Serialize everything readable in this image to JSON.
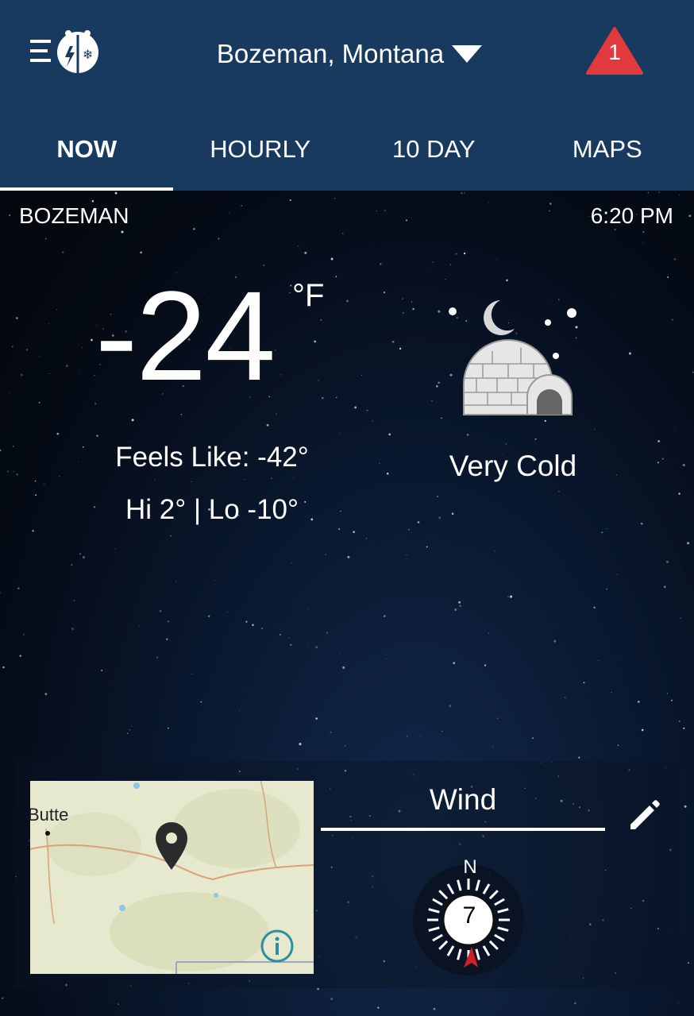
{
  "header": {
    "location": "Bozeman, Montana",
    "alert_count": "1",
    "menu_icon": "menu-logo-icon",
    "alert_icon": "alert-triangle-icon"
  },
  "tabs": [
    {
      "label": "NOW",
      "active": true
    },
    {
      "label": "HOURLY",
      "active": false
    },
    {
      "label": "10 DAY",
      "active": false
    },
    {
      "label": "MAPS",
      "active": false
    }
  ],
  "current": {
    "city": "BOZEMAN",
    "time": "6:20 PM",
    "temperature": "-24",
    "unit": "°F",
    "feels_like": "Feels Like: -42°",
    "hi_lo": "Hi 2° | Lo -10°",
    "condition": "Very Cold",
    "condition_icon": "igloo-moon-icon"
  },
  "map": {
    "label": "Butte",
    "info_icon": "info-icon",
    "pin_icon": "location-pin-icon"
  },
  "wind": {
    "title": "Wind",
    "direction_label": "N",
    "speed": "7",
    "edit_icon": "pencil-icon"
  },
  "colors": {
    "header_bg": "#173a5e",
    "alert_red": "#e03a3e",
    "compass_red": "#d11f2a"
  }
}
